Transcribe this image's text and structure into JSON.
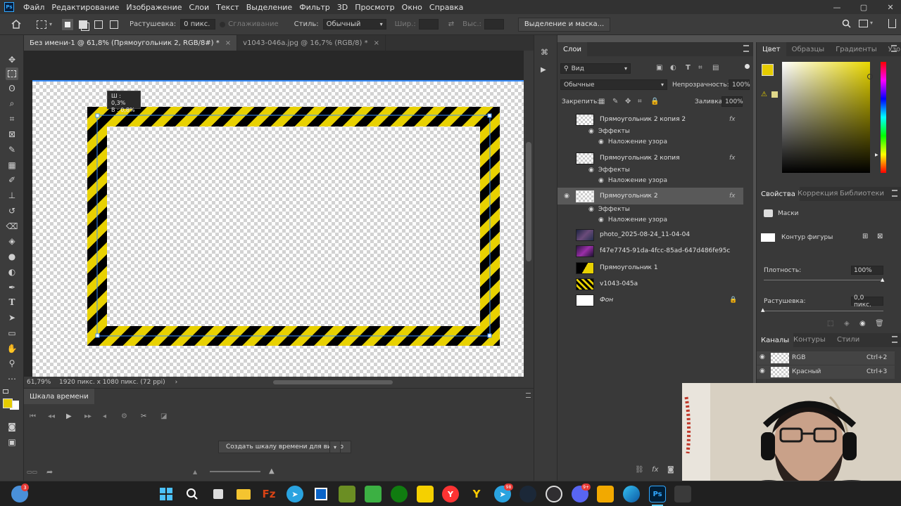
{
  "app": {
    "logo": "Ps"
  },
  "menu": [
    "Файл",
    "Редактирование",
    "Изображение",
    "Слои",
    "Текст",
    "Выделение",
    "Фильтр",
    "3D",
    "Просмотр",
    "Окно",
    "Справка"
  ],
  "window_controls": [
    "—",
    "▢",
    "✕"
  ],
  "options_bar": {
    "feather_label": "Растушевка:",
    "feather_value": "0 пикс.",
    "antialias_label": "Сглаживание",
    "style_label": "Стиль:",
    "style_value": "Обычный",
    "width_label": "Шир.:",
    "height_label": "Выс.:",
    "select_mask_button": "Выделение и маска..."
  },
  "document_tabs": [
    {
      "label": "Без имени-1 @ 61,8% (Прямоугольник 2, RGB/8#) *",
      "close": "×"
    },
    {
      "label": "v1043-046a.jpg @ 16,7% (RGB/8) *",
      "close": "×"
    }
  ],
  "tooltip": {
    "w": "Ш : 0,3%",
    "h": "В : 0,8%"
  },
  "status_bar": {
    "zoom": "61,79%",
    "doc_size": "1920 пикс. x 1080 пикс. (72 ppi)",
    "arrow": "›"
  },
  "timeline": {
    "title": "Шкала времени",
    "create_button": "Создать шкалу времени для видео"
  },
  "layers_panel": {
    "tab": "Слои",
    "filter_kind": "Вид",
    "blend_mode": "Обычные",
    "opacity_label": "Непрозрачность:",
    "opacity_value": "100%",
    "lock_label": "Закрепить:",
    "fill_label": "Заливка:",
    "fill_value": "100%",
    "layers": [
      {
        "name": "Прямоугольник 2 копия 2",
        "visible": false,
        "fx": "fx",
        "effects_label": "Эффекты",
        "effect": "Наложение узора"
      },
      {
        "name": "Прямоугольник 2 копия",
        "visible": false,
        "fx": "fx",
        "effects_label": "Эффекты",
        "effect": "Наложение узора"
      },
      {
        "name": "Прямоугольник 2",
        "visible": true,
        "selected": true,
        "fx": "fx",
        "effects_label": "Эффекты",
        "effect": "Наложение узора"
      },
      {
        "name": "photo_2025-08-24_11-04-04",
        "visible": false
      },
      {
        "name": "f47e7745-91da-4fcc-85ad-647d486fe95c",
        "visible": false
      },
      {
        "name": "Прямоугольник 1",
        "visible": false
      },
      {
        "name": "v1043-045a",
        "visible": false
      },
      {
        "name": "Фон",
        "visible": false,
        "locked": true
      }
    ]
  },
  "color_panel": {
    "tabs": [
      "Цвет",
      "Образцы",
      "Градиенты",
      "Узоры"
    ],
    "foreground": "#e6cc00"
  },
  "properties_panel": {
    "tabs": [
      "Свойства",
      "Коррекция",
      "Библиотеки"
    ],
    "masks_label": "Маски",
    "shape_label": "Контур фигуры",
    "density_label": "Плотность:",
    "density_value": "100%",
    "density_fraction": 1.0,
    "feather_label": "Растушевка:",
    "feather_value": "0,0 пикс.",
    "feather_fraction": 0.0
  },
  "channels_panel": {
    "tabs": [
      "Каналы",
      "Контуры",
      "Стили"
    ],
    "channels": [
      {
        "name": "RGB",
        "shortcut": "Ctrl+2"
      },
      {
        "name": "Красный",
        "shortcut": "Ctrl+3"
      }
    ]
  },
  "colors": {
    "hazard_yellow": "#e8d100",
    "hazard_black": "#000000",
    "selection_blue": "#3a8fff"
  },
  "taskbar_icons": [
    "start-icon",
    "search-icon",
    "task-view-icon",
    "file-explorer-icon",
    "filezilla-icon",
    "telegram-icon",
    "app-icon",
    "minecraft-icon",
    "minecraft-icon",
    "xbox-icon",
    "sticky-icon",
    "yandex-icon",
    "yandex-music-icon",
    "telegram-icon",
    "steam-icon",
    "obs-icon",
    "discord-icon",
    "unity-icon",
    "edge-icon",
    "photoshop-icon",
    "app-icon"
  ],
  "taskbar_badges": {
    "widgets": "3",
    "telegram": "98",
    "discord": "9+"
  }
}
